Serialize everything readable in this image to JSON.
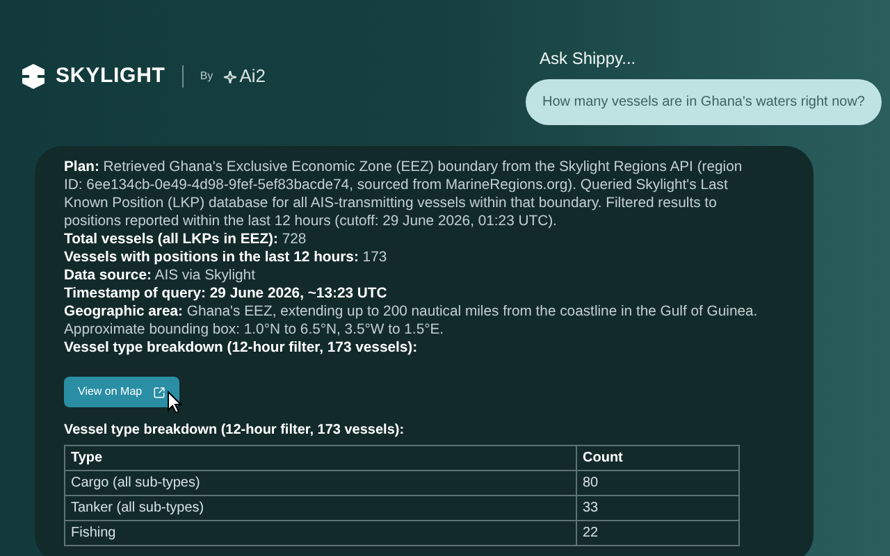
{
  "header": {
    "brand": "SKYLIGHT",
    "by": "By",
    "partner": "Ai2"
  },
  "chat": {
    "prompt_label": "Ask Shippy...",
    "question": "How many vessels are in Ghana's waters right now?"
  },
  "answer": {
    "lines": [
      "**Plan:** Retrieved Ghana's Exclusive Economic Zone (EEZ) boundary from the Skylight Regions API (region ID: 6ee134cb-0e49-4d98-9fef-5ef83bacde74, sourced from MarineRegions.org). Queried Skylight's Last Known Position (LKP) database for all AIS-transmitting vessels within that boundary. Filtered results to positions reported within the last 12 hours (cutoff: 29 June 2026, 01:23 UTC).",
      "**Total vessels (all LKPs in EEZ):** 728",
      "**Vessels with positions in the last 12 hours:** 173",
      "**Data source:** AIS via Skylight",
      "**Timestamp of query: 29 June 2026, ~13:23 UTC**",
      "**Geographic area:** Ghana's EEZ, extending up to 200 nautical miles from the coastline in the Gulf of Guinea. Approximate bounding box: 1.0°N to 6.5°N, 3.5°W to 1.5°E.",
      "**Vessel type breakdown (12-hour filter, 173 vessels):**"
    ],
    "map_button": "View on Map",
    "table_title": "Vessel type breakdown (12-hour filter, 173 vessels):",
    "table": {
      "columns": [
        "Type",
        "Count"
      ],
      "rows": [
        [
          "Cargo (all sub-types)",
          "80"
        ],
        [
          "Tanker (all sub-types)",
          "33"
        ],
        [
          "Fishing",
          "22"
        ]
      ]
    }
  }
}
